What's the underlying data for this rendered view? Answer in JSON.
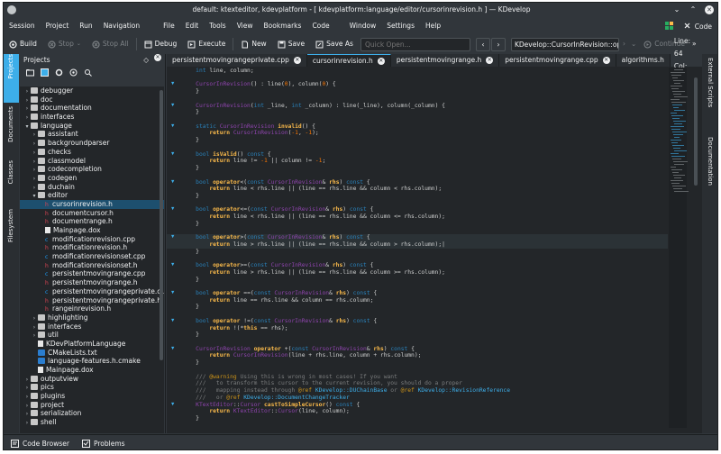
{
  "window": {
    "title": "default: ktexteditor, kdevplatform - [ kdevplatform:language/editor/cursorinrevision.h ] — KDevelop"
  },
  "menubar": {
    "left": [
      "Session",
      "Project",
      "Run",
      "Navigation"
    ],
    "right": [
      "File",
      "Edit",
      "Tools",
      "View",
      "Bookmarks",
      "Code",
      "Window",
      "Settings",
      "Help"
    ],
    "mode_label": "Code"
  },
  "toolbar": {
    "build": "Build",
    "stop": "Stop",
    "stop_all": "Stop All",
    "debug": "Debug",
    "execute": "Execute",
    "new": "New",
    "save": "Save",
    "save_as": "Save As",
    "quick_open_placeholder": "Quick Open...",
    "context": "KDevelop::CursorInRevision::operat",
    "continue": "Continue"
  },
  "left_tabs": [
    "Projects",
    "Documents",
    "Classes",
    "Filesystem"
  ],
  "right_tabs": [
    "External Scripts",
    "Documentation"
  ],
  "projects_panel": {
    "title": "Projects",
    "tree": [
      {
        "label": "debugger",
        "indent": 0,
        "type": "folder",
        "arrow": "›"
      },
      {
        "label": "doc",
        "indent": 0,
        "type": "folder",
        "arrow": "›"
      },
      {
        "label": "documentation",
        "indent": 0,
        "type": "folder",
        "arrow": "›"
      },
      {
        "label": "interfaces",
        "indent": 0,
        "type": "folder",
        "arrow": "›"
      },
      {
        "label": "language",
        "indent": 0,
        "type": "folder",
        "arrow": "⌄"
      },
      {
        "label": "assistant",
        "indent": 1,
        "type": "folder",
        "arrow": "›"
      },
      {
        "label": "backgroundparser",
        "indent": 1,
        "type": "folder",
        "arrow": "›"
      },
      {
        "label": "checks",
        "indent": 1,
        "type": "folder",
        "arrow": "›"
      },
      {
        "label": "classmodel",
        "indent": 1,
        "type": "folder",
        "arrow": "›"
      },
      {
        "label": "codecompletion",
        "indent": 1,
        "type": "folder",
        "arrow": "›"
      },
      {
        "label": "codegen",
        "indent": 1,
        "type": "folder",
        "arrow": "›"
      },
      {
        "label": "duchain",
        "indent": 1,
        "type": "folder",
        "arrow": "›"
      },
      {
        "label": "editor",
        "indent": 1,
        "type": "folder",
        "arrow": "⌄"
      },
      {
        "label": "cursorinrevision.h",
        "indent": 2,
        "type": "h",
        "arrow": "",
        "selected": true
      },
      {
        "label": "documentcursor.h",
        "indent": 2,
        "type": "h",
        "arrow": ""
      },
      {
        "label": "documentrange.h",
        "indent": 2,
        "type": "h",
        "arrow": ""
      },
      {
        "label": "Mainpage.dox",
        "indent": 2,
        "type": "file",
        "arrow": ""
      },
      {
        "label": "modificationrevision.cpp",
        "indent": 2,
        "type": "cpp",
        "arrow": ""
      },
      {
        "label": "modificationrevision.h",
        "indent": 2,
        "type": "h",
        "arrow": ""
      },
      {
        "label": "modificationrevisionset.cpp",
        "indent": 2,
        "type": "cpp",
        "arrow": ""
      },
      {
        "label": "modificationrevisionset.h",
        "indent": 2,
        "type": "h",
        "arrow": ""
      },
      {
        "label": "persistentmovingrange.cpp",
        "indent": 2,
        "type": "cpp",
        "arrow": ""
      },
      {
        "label": "persistentmovingrange.h",
        "indent": 2,
        "type": "h",
        "arrow": ""
      },
      {
        "label": "persistentmovingrangeprivate.c...",
        "indent": 2,
        "type": "cpp",
        "arrow": ""
      },
      {
        "label": "persistentmovingrangeprivate.h",
        "indent": 2,
        "type": "h",
        "arrow": ""
      },
      {
        "label": "rangeinrevision.h",
        "indent": 2,
        "type": "h",
        "arrow": ""
      },
      {
        "label": "highlighting",
        "indent": 1,
        "type": "folder",
        "arrow": "›"
      },
      {
        "label": "interfaces",
        "indent": 1,
        "type": "folder",
        "arrow": "›"
      },
      {
        "label": "util",
        "indent": 1,
        "type": "folder",
        "arrow": "›"
      },
      {
        "label": "KDevPlatformLanguage",
        "indent": 1,
        "type": "file",
        "arrow": ""
      },
      {
        "label": "CMakeLists.txt",
        "indent": 1,
        "type": "cmake",
        "arrow": ""
      },
      {
        "label": "language-features.h.cmake",
        "indent": 1,
        "type": "cmake",
        "arrow": ""
      },
      {
        "label": "Mainpage.dox",
        "indent": 1,
        "type": "file",
        "arrow": ""
      },
      {
        "label": "outputview",
        "indent": 0,
        "type": "folder",
        "arrow": "›"
      },
      {
        "label": "pics",
        "indent": 0,
        "type": "folder",
        "arrow": "›"
      },
      {
        "label": "plugins",
        "indent": 0,
        "type": "folder",
        "arrow": "›"
      },
      {
        "label": "project",
        "indent": 0,
        "type": "folder",
        "arrow": "›"
      },
      {
        "label": "serialization",
        "indent": 0,
        "type": "folder",
        "arrow": "›"
      },
      {
        "label": "shell",
        "indent": 0,
        "type": "folder",
        "arrow": "›"
      }
    ]
  },
  "editor": {
    "tabs": [
      {
        "label": "persistentmovingrangeprivate.cpp",
        "active": false
      },
      {
        "label": "cursorinrevision.h",
        "active": true
      },
      {
        "label": "persistentmovingrange.h",
        "active": false
      },
      {
        "label": "persistentmovingrange.cpp",
        "active": false
      },
      {
        "label": "algorithms.h",
        "active": false
      }
    ],
    "line_col": "Line: 64 Col: 74",
    "code_lines": [
      {
        "fold": false,
        "html": "    <span class=\"ty\">int</span> line, column;"
      },
      {
        "fold": false,
        "html": ""
      },
      {
        "fold": true,
        "html": "    <span class=\"fn\">CursorInRevision</span>() : line(<span class=\"num\">0</span>), column(<span class=\"num\">0</span>) {"
      },
      {
        "fold": false,
        "html": "    }"
      },
      {
        "fold": false,
        "html": ""
      },
      {
        "fold": true,
        "html": "    <span class=\"fn\">CursorInRevision</span>(<span class=\"ty\">int</span> _line, <span class=\"ty\">int</span> _column) : line(_line), column(_column) {"
      },
      {
        "fold": false,
        "html": "    }"
      },
      {
        "fold": false,
        "html": ""
      },
      {
        "fold": true,
        "html": "    <span class=\"ty\">static</span> <span class=\"fn\">CursorInRevision</span> <span class=\"kw\">invalid</span>() {"
      },
      {
        "fold": false,
        "html": "        <span class=\"kw\">return</span> <span class=\"fn\">CursorInRevision</span>(<span class=\"num\">-1</span>, <span class=\"num\">-1</span>);"
      },
      {
        "fold": false,
        "html": "    }"
      },
      {
        "fold": false,
        "html": ""
      },
      {
        "fold": true,
        "html": "    <span class=\"ty\">bool</span> <span class=\"kw\">isValid</span>() <span class=\"ty\">const</span> {"
      },
      {
        "fold": false,
        "html": "        <span class=\"kw\">return</span> line != <span class=\"num\">-1</span> || column != <span class=\"num\">-1</span>;"
      },
      {
        "fold": false,
        "html": "    }"
      },
      {
        "fold": false,
        "html": ""
      },
      {
        "fold": true,
        "html": "    <span class=\"ty\">bool</span> <span class=\"kw\">operator</span><(<span class=\"ty\">const</span> <span class=\"fn\">CursorInRevision</span>& <span class=\"kw\">rhs</span>) <span class=\"ty\">const</span> {"
      },
      {
        "fold": false,
        "html": "        <span class=\"kw\">return</span> line < rhs.line || (line == rhs.line && column < rhs.column);"
      },
      {
        "fold": false,
        "html": "    }"
      },
      {
        "fold": false,
        "html": ""
      },
      {
        "fold": true,
        "html": "    <span class=\"ty\">bool</span> <span class=\"kw\">operator</span><=(<span class=\"ty\">const</span> <span class=\"fn\">CursorInRevision</span>& <span class=\"kw\">rhs</span>) <span class=\"ty\">const</span> {"
      },
      {
        "fold": false,
        "html": "        <span class=\"kw\">return</span> line < rhs.line || (line == rhs.line && column <= rhs.column);"
      },
      {
        "fold": false,
        "html": "    }"
      },
      {
        "fold": false,
        "html": ""
      },
      {
        "fold": true,
        "cur": true,
        "html": "    <span class=\"ty\">bool</span> <span class=\"kw\">operator</span>>(<span class=\"ty\">const</span> <span class=\"fn\">CursorInRevision</span>& <span class=\"kw\">rhs</span>) <span class=\"ty\">const</span> {"
      },
      {
        "fold": false,
        "cur": true,
        "html": "        <span class=\"kw\">return</span> line > rhs.line || (line == rhs.line && column > rhs.column);|"
      },
      {
        "fold": false,
        "html": "    }"
      },
      {
        "fold": false,
        "html": ""
      },
      {
        "fold": true,
        "html": "    <span class=\"ty\">bool</span> <span class=\"kw\">operator</span>>=(<span class=\"ty\">const</span> <span class=\"fn\">CursorInRevision</span>& <span class=\"kw\">rhs</span>) <span class=\"ty\">const</span> {"
      },
      {
        "fold": false,
        "html": "        <span class=\"kw\">return</span> line > rhs.line || (line == rhs.line && column >= rhs.column);"
      },
      {
        "fold": false,
        "html": "    }"
      },
      {
        "fold": false,
        "html": ""
      },
      {
        "fold": true,
        "html": "    <span class=\"ty\">bool</span> <span class=\"kw\">operator</span> ==(<span class=\"ty\">const</span> <span class=\"fn\">CursorInRevision</span>& <span class=\"kw\">rhs</span>) <span class=\"ty\">const</span> {"
      },
      {
        "fold": false,
        "html": "        <span class=\"kw\">return</span> line == rhs.line && column == rhs.column;"
      },
      {
        "fold": false,
        "html": "    }"
      },
      {
        "fold": false,
        "html": ""
      },
      {
        "fold": true,
        "html": "    <span class=\"ty\">bool</span> <span class=\"kw\">operator</span> !=(<span class=\"ty\">const</span> <span class=\"fn\">CursorInRevision</span>& <span class=\"kw\">rhs</span>) <span class=\"ty\">const</span> {"
      },
      {
        "fold": false,
        "html": "        <span class=\"kw\">return</span> !(*<span class=\"kw\">this</span> == rhs);"
      },
      {
        "fold": false,
        "html": "    }"
      },
      {
        "fold": false,
        "html": ""
      },
      {
        "fold": true,
        "html": "    <span class=\"fn\">CursorInRevision</span> <span class=\"kw\">operator</span> +(<span class=\"ty\">const</span> <span class=\"fn\">CursorInRevision</span>& <span class=\"kw\">rhs</span>) <span class=\"ty\">const</span> {"
      },
      {
        "fold": false,
        "html": "        <span class=\"kw\">return</span> <span class=\"fn\">CursorInRevision</span>(line + rhs.line, column + rhs.column);"
      },
      {
        "fold": false,
        "html": "    }"
      },
      {
        "fold": false,
        "html": ""
      },
      {
        "fold": false,
        "html": "    <span class=\"ce\">/// </span><span class=\"ck\">@warning</span><span class=\"ce\"> Using this is wrong in most cases! If you want</span>"
      },
      {
        "fold": false,
        "html": "    <span class=\"ce\">///   to transform this cursor to the current revision, you should do a proper</span>"
      },
      {
        "fold": false,
        "html": "    <span class=\"ce\">///   mapping instead through </span><span class=\"ck\">@ref</span><span class=\"ce\"> </span><span class=\"mm\">KDevelop::DUChainBase</span><span class=\"ce\"> or </span><span class=\"ck\">@ref</span><span class=\"ce\"> </span><span class=\"mm\">KDevelop::RevisionReference</span>"
      },
      {
        "fold": false,
        "html": "    <span class=\"ce\">///   or </span><span class=\"ck\">@ref</span><span class=\"ce\"> </span><span class=\"mm\">KDevelop::DocumentChangeTracker</span>"
      },
      {
        "fold": true,
        "html": "    <span class=\"fn\">KTextEditor</span>::<span class=\"fn\">Cursor</span> <span class=\"kw\">castToSimpleCursor</span>() <span class=\"ty\">const</span> {"
      },
      {
        "fold": false,
        "html": "        <span class=\"kw\">return</span> <span class=\"fn\">KTextEditor</span>::<span class=\"fn\">Cursor</span>(line, column);"
      },
      {
        "fold": false,
        "html": "    }"
      }
    ]
  },
  "statusbar": {
    "code_browser": "Code Browser",
    "problems": "Problems"
  }
}
